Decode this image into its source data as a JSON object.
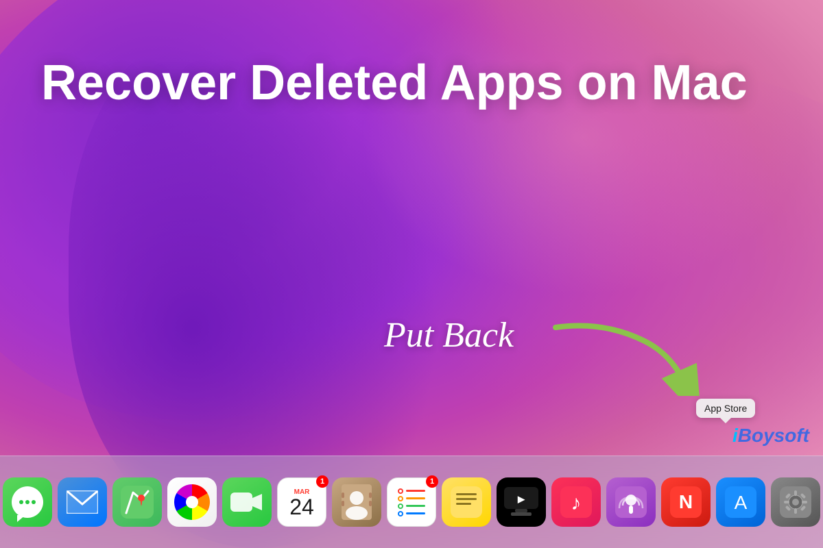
{
  "desktop": {
    "title": "Recover Deleted Apps on Mac",
    "put_back_label": "Put Back",
    "arrow_color": "#8BC34A",
    "gradient_colors": {
      "start": "#7B2FBE",
      "mid": "#C040B0",
      "end": "#F0A0C0"
    }
  },
  "tooltip": {
    "label": "App Store"
  },
  "branding": {
    "logo": "iBoysoft",
    "logo_i": "i",
    "logo_rest": "Boysoft"
  },
  "dock": {
    "icons": [
      {
        "id": "messages",
        "label": "Messages",
        "emoji": "💬",
        "class": "icon-messages",
        "badge": null
      },
      {
        "id": "mail",
        "label": "Mail",
        "emoji": "✉️",
        "class": "icon-mail",
        "badge": null
      },
      {
        "id": "maps",
        "label": "Maps",
        "emoji": "🗺️",
        "class": "icon-maps",
        "badge": null
      },
      {
        "id": "photos",
        "label": "Photos",
        "emoji": "photos",
        "class": "icon-photos",
        "badge": null
      },
      {
        "id": "facetime",
        "label": "FaceTime",
        "emoji": "📹",
        "class": "icon-facetime",
        "badge": null
      },
      {
        "id": "calendar",
        "label": "Calendar",
        "emoji": "calendar",
        "class": "icon-calendar",
        "badge": "1"
      },
      {
        "id": "contacts",
        "label": "Contacts",
        "emoji": "contacts",
        "class": "icon-contacts",
        "badge": null
      },
      {
        "id": "reminders",
        "label": "Reminders",
        "emoji": "reminders",
        "class": "icon-reminders",
        "badge": "1"
      },
      {
        "id": "notes",
        "label": "Notes",
        "emoji": "notes",
        "class": "icon-notes",
        "badge": null
      },
      {
        "id": "tv",
        "label": "Apple TV",
        "emoji": "tv",
        "class": "icon-tv",
        "badge": null
      },
      {
        "id": "music",
        "label": "Music",
        "emoji": "🎵",
        "class": "icon-music",
        "badge": null
      },
      {
        "id": "podcasts",
        "label": "Podcasts",
        "emoji": "podcasts",
        "class": "icon-podcasts",
        "badge": null
      },
      {
        "id": "news",
        "label": "News",
        "emoji": "news",
        "class": "icon-news",
        "badge": null
      },
      {
        "id": "appstore",
        "label": "App Store",
        "emoji": "appstore",
        "class": "icon-appstore",
        "badge": null
      },
      {
        "id": "sysprefs",
        "label": "System Preferences",
        "emoji": "sysprefs",
        "class": "icon-sysprefs",
        "badge": null
      }
    ],
    "calendar_month": "MAR",
    "calendar_day": "24"
  }
}
